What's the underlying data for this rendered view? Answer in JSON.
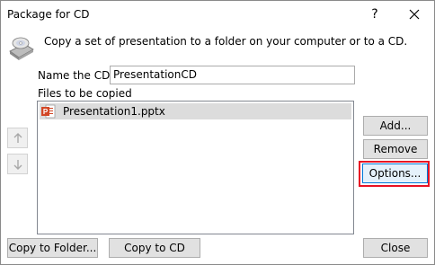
{
  "window": {
    "title": "Package for CD",
    "help": "?"
  },
  "instruction": "Copy a set of presentation to a folder on your computer or to a CD.",
  "name_field": {
    "label": "Name the CD:",
    "value": "PresentationCD"
  },
  "files": {
    "label": "Files to be copied",
    "items": [
      {
        "name": "Presentation1.pptx"
      }
    ]
  },
  "buttons": {
    "add": "Add...",
    "remove": "Remove",
    "options": "Options...",
    "copy_to_folder": "Copy to Folder...",
    "copy_to_cd": "Copy to CD",
    "close": "Close"
  },
  "icons": {
    "disc": "cd-drive-icon",
    "file": "pptx-file-icon",
    "up": "arrow-up-icon",
    "down": "arrow-down-icon",
    "close": "close-icon"
  },
  "colors": {
    "highlight": "#e81123",
    "selection": "#dcdcdc",
    "pptx": "#d24726"
  }
}
